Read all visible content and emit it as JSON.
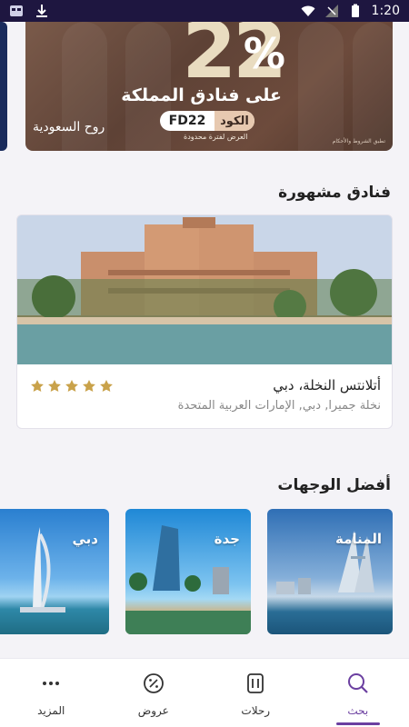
{
  "status_bar": {
    "time": "1:20"
  },
  "promo": {
    "percent": "22",
    "percent_sign": "%",
    "headline": "على فنادق المملكة",
    "code_label": "الكود",
    "code_value": "FD22",
    "limited_note": "العرض لفترة محدودة",
    "terms": "تطبق الشروط والأحكام",
    "brand": "روح السعودية"
  },
  "featured_hotels": {
    "title": "فنادق مشهورة",
    "hotels": [
      {
        "name": "أتلانتس النخلة، دبي",
        "location": "نخلة جميرا, دبي, الإمارات العربية المتحدة",
        "rating": 5
      }
    ]
  },
  "destinations": {
    "title": "أفضل الوجهات",
    "items": [
      {
        "label": "المنامة"
      },
      {
        "label": "جدة"
      },
      {
        "label": "دبي"
      }
    ]
  },
  "bottom_nav": {
    "items": [
      {
        "label": "المزيد",
        "icon": "more-icon"
      },
      {
        "label": "عروض",
        "icon": "offers-icon"
      },
      {
        "label": "رحلات",
        "icon": "trips-icon"
      },
      {
        "label": "بحث",
        "icon": "search-icon",
        "active": true
      }
    ],
    "accent": "#6b3fa0"
  }
}
